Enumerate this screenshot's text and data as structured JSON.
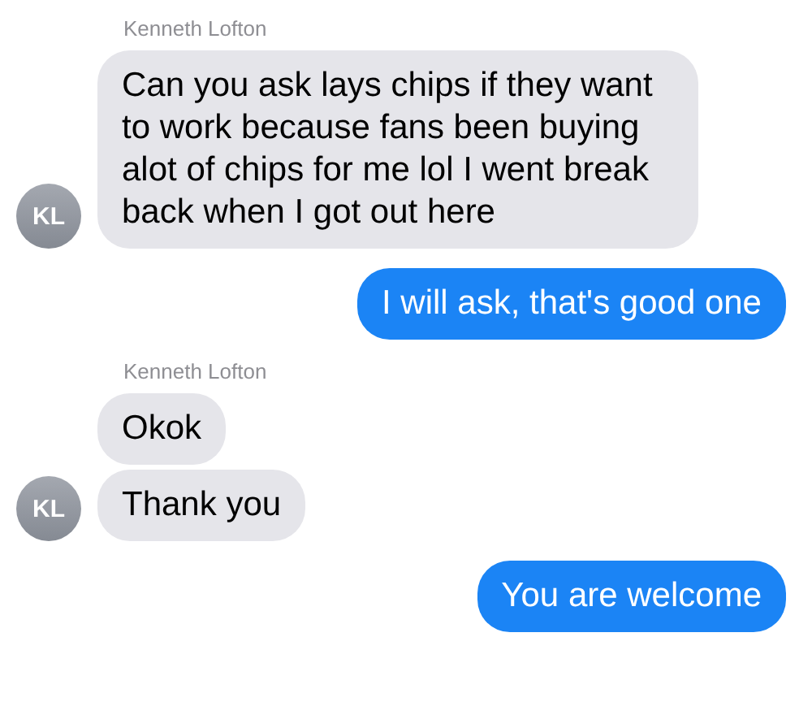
{
  "groups": [
    {
      "kind": "incoming",
      "sender": "Kenneth Lofton",
      "avatar": "KL",
      "messages": [
        "Can you ask lays chips if they want to work because fans been buying alot of chips for me lol I went break back when I got out here"
      ]
    },
    {
      "kind": "outgoing",
      "messages": [
        "I will ask, that's good one"
      ]
    },
    {
      "kind": "incoming",
      "sender": "Kenneth Lofton",
      "avatar": "KL",
      "messages": [
        "Okok",
        "Thank you"
      ]
    },
    {
      "kind": "outgoing",
      "messages": [
        "You are welcome"
      ]
    }
  ]
}
